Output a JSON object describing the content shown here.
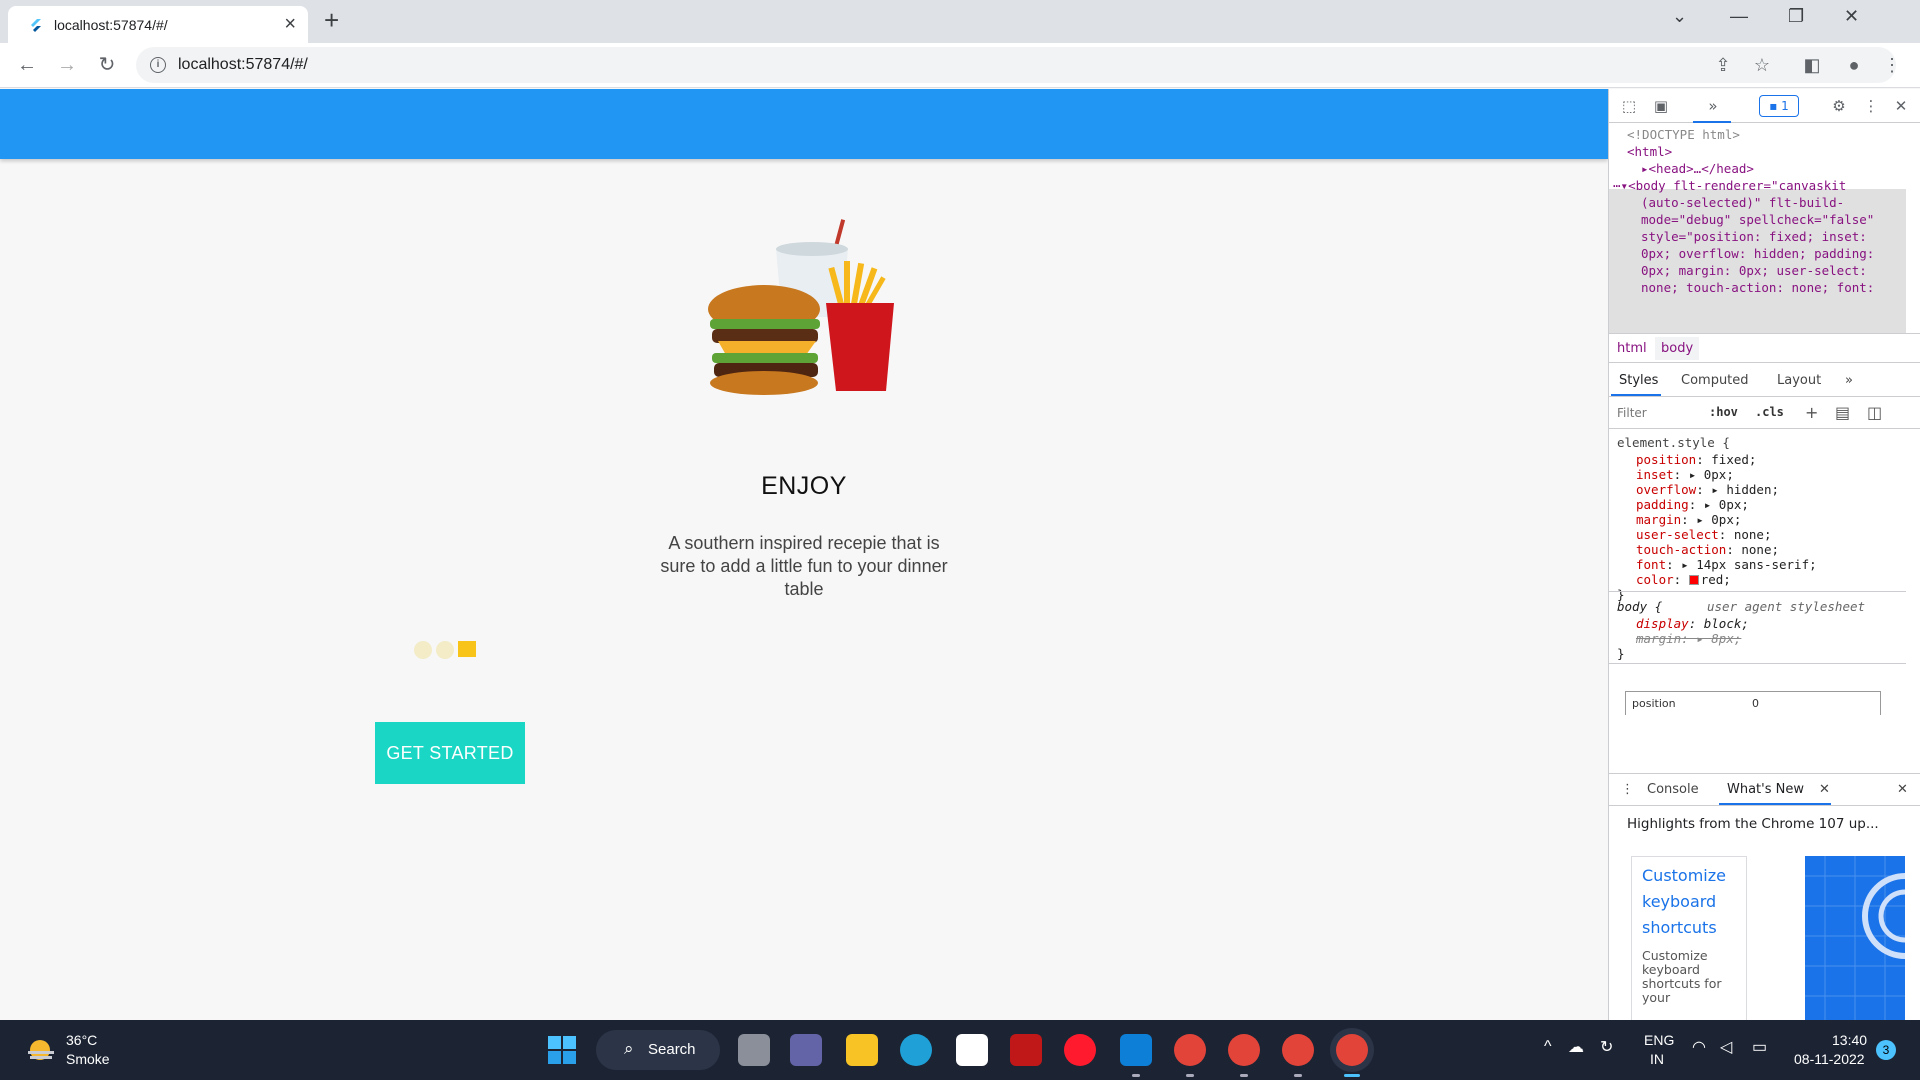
{
  "browser": {
    "tab_title": "localhost:57874/#/",
    "url": "localhost:57874/#/"
  },
  "app": {
    "heading": "ENJOY",
    "description": "A southern inspired recepie that is sure to add a little fun to your dinner table",
    "button_label": "GET STARTED",
    "appbar_color": "#2196f3",
    "button_color": "#1ad6c4"
  },
  "devtools": {
    "issues_count": "1",
    "dom": {
      "doctype": "<!DOCTYPE html>",
      "html_open": "<html>",
      "head": "<head>…</head>",
      "body_lines": [
        "<body flt-renderer=\"canvaskit",
        "(auto-selected)\" flt-build-",
        "mode=\"debug\" spellcheck=\"false\"",
        "style=\"position: fixed; inset:",
        "0px; overflow: hidden; padding:",
        "0px; margin: 0px; user-select:",
        "none; touch-action: none; font:"
      ]
    },
    "breadcrumbs": [
      "html",
      "body"
    ],
    "style_tabs": [
      "Styles",
      "Computed",
      "Layout"
    ],
    "filter_placeholder": "Filter",
    "hov": ":hov",
    "cls": ".cls",
    "element_style": {
      "selector": "element.style {",
      "props": [
        {
          "name": "position",
          "value": "fixed;"
        },
        {
          "name": "inset",
          "value": "0px;"
        },
        {
          "name": "overflow",
          "value": "hidden;"
        },
        {
          "name": "padding",
          "value": "0px;"
        },
        {
          "name": "margin",
          "value": "0px;"
        },
        {
          "name": "user-select",
          "value": "none;"
        },
        {
          "name": "touch-action",
          "value": "none;"
        },
        {
          "name": "font",
          "value": "14px sans-serif;"
        },
        {
          "name": "color",
          "value": "red;"
        }
      ]
    },
    "ua_rule": {
      "selector": "body {",
      "source": "user agent stylesheet",
      "props": [
        {
          "name": "display",
          "value": "block;"
        },
        {
          "name": "margin",
          "value": "8px;"
        }
      ]
    },
    "box_model": {
      "label": "position",
      "value": "0"
    },
    "drawer_tabs": [
      "Console",
      "What's New"
    ],
    "highlights": "Highlights from the Chrome 107 up...",
    "card_link": "Customize keyboard shortcuts",
    "card_body": "Customize keyboard shortcuts for your"
  },
  "taskbar": {
    "temp": "36°C",
    "weather": "Smoke",
    "search": "Search",
    "lang1": "ENG",
    "lang2": "IN",
    "time": "13:40",
    "date": "08-11-2022",
    "notifications": "3"
  }
}
